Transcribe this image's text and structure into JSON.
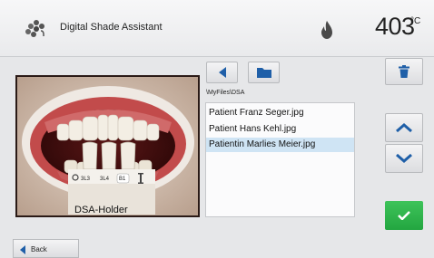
{
  "header": {
    "app_icon": "teeth-cluster-icon",
    "title": "Digital Shade Assistant",
    "status_icon": "flame-icon",
    "temperature": "403",
    "temperature_unit": "°C"
  },
  "navigation": {
    "prev_icon": "left-arrow-icon",
    "folder_icon": "folder-icon",
    "path": "\\MyFiles\\DSA"
  },
  "files": [
    {
      "name": "Patient Franz Seger.jpg",
      "selected": false
    },
    {
      "name": "Patient Hans Kehl.jpg",
      "selected": false
    },
    {
      "name": "Patientin Marlies Meier.jpg",
      "selected": true
    }
  ],
  "preview": {
    "shade_tabs": [
      "3L3",
      "3L4",
      "B1"
    ],
    "holder_label": "DSA-Holder"
  },
  "actions": {
    "delete_icon": "trash-icon",
    "up_icon": "chevron-up-icon",
    "down_icon": "chevron-down-icon",
    "confirm_icon": "checkmark-icon"
  },
  "footer": {
    "back_label": "Back"
  },
  "colors": {
    "accent_blue": "#1f5fa8",
    "confirm_green": "#2bb24c",
    "selection": "#cfe4f4"
  }
}
